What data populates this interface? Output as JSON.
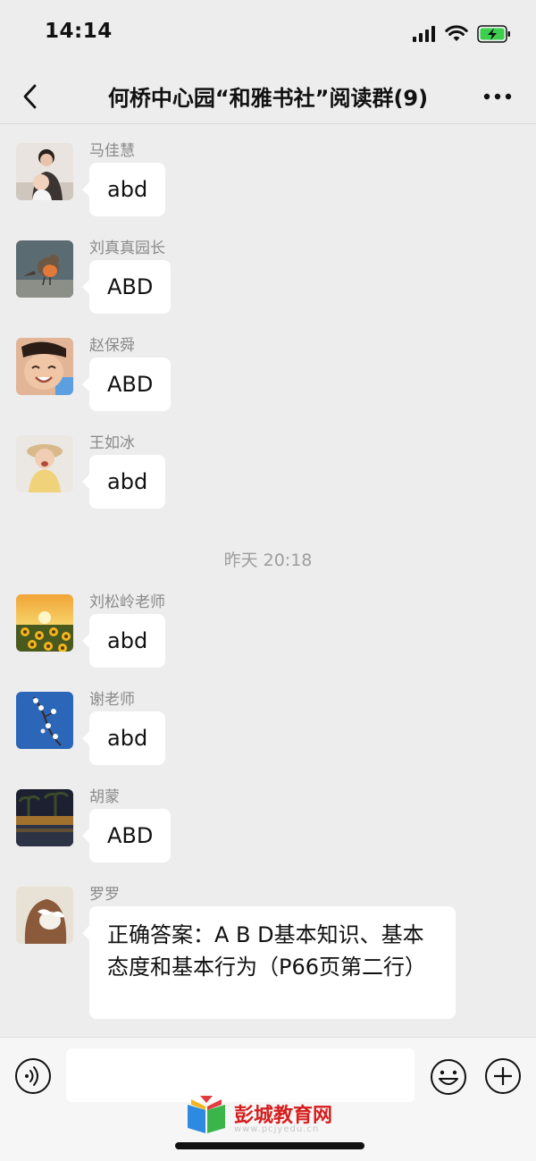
{
  "status_bar": {
    "time": "14:14",
    "battery": "charging",
    "signal": "4 bars",
    "wifi": "on"
  },
  "nav": {
    "title": "何桥中心园“和雅书社”阅读群(9)"
  },
  "messages": [
    {
      "sender": "马佳慧",
      "text": "abd",
      "avatar": "mother-with-baby-avatar"
    },
    {
      "sender": "刘真真园长",
      "text": "ABD",
      "avatar": "robin-bird-avatar"
    },
    {
      "sender": "赵保舜",
      "text": "ABD",
      "avatar": "smiling-child-avatar"
    },
    {
      "sender": "王如冰",
      "text": "abd",
      "avatar": "girl-in-hat-avatar"
    },
    {
      "sender": "刘松岭老师",
      "text": "abd",
      "avatar": "sunflower-field-avatar"
    },
    {
      "sender": "谢老师",
      "text": "abd",
      "avatar": "blossom-branch-avatar"
    },
    {
      "sender": "胡蒙",
      "text": "ABD",
      "avatar": "night-palms-avatar"
    },
    {
      "sender": "罗罗",
      "text": "正确答案：A B D基本知识、基本态度和基本行为（P66页第二行）",
      "avatar": "hair-bow-avatar"
    }
  ],
  "timestamp": "昨天 20:18",
  "input": {
    "placeholder": ""
  },
  "watermark": {
    "text": "彭城教育网",
    "url": "www.pcjyedu.cn"
  },
  "colors": {
    "background": "#ededed",
    "bubble": "#ffffff",
    "sender": "#8a8a8a",
    "watermark": "#d71e1e"
  }
}
